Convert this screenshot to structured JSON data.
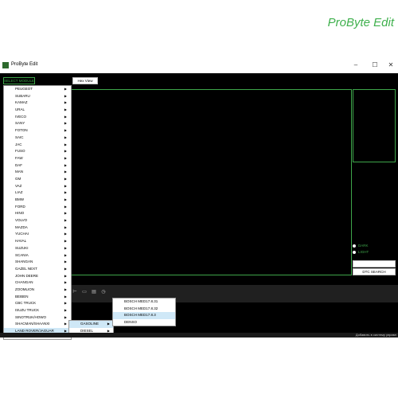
{
  "window": {
    "title": "ProByte Edit"
  },
  "toolbar_top": {
    "select_module": "SELECT MODULE",
    "hex_view": "Hex View"
  },
  "brand": "ProByte Edit",
  "theme": {
    "dark": "DARK",
    "light": "LIGHT"
  },
  "dtc_search": "DTC SEARCH",
  "brands": [
    "PEUGEOT",
    "SUBARU",
    "KAMAZ",
    "URAL",
    "IVECO",
    "SANY",
    "FOTON",
    "SAIC",
    "JAC",
    "FUSO",
    "FAW",
    "DAF",
    "MAN",
    "GM",
    "VAZ",
    "LIAZ",
    "BMW",
    "FORD",
    "HINO",
    "VOLVO",
    "MAZDA",
    "YUCHAI",
    "HAVAL",
    "SUZUKI",
    "SCANIA",
    "SHANGAN",
    "GAZEL NEXT",
    "JOHN DEERE",
    "CHANGAN",
    "ZOOMLION",
    "BEIBEN",
    "CBC TRUCK",
    "ISUZU TRUCK",
    "SINOTRUK/HOWO",
    "SHACMAN/SHAANXI",
    "LAND ROVER/JAGUAR"
  ],
  "fuel_menu": [
    "GASOLINE",
    "DIESEL"
  ],
  "ecu_menu": [
    "BOSCH MED17.8.31",
    "BOSCH MED17.8.32",
    "BOSCH MED17.8.3",
    "DENSO"
  ],
  "taskbar_text": "Добавить в систему управл",
  "colors": {
    "accent": "#3ea54a",
    "background": "#000000",
    "highlight": "#cfe8f7"
  }
}
